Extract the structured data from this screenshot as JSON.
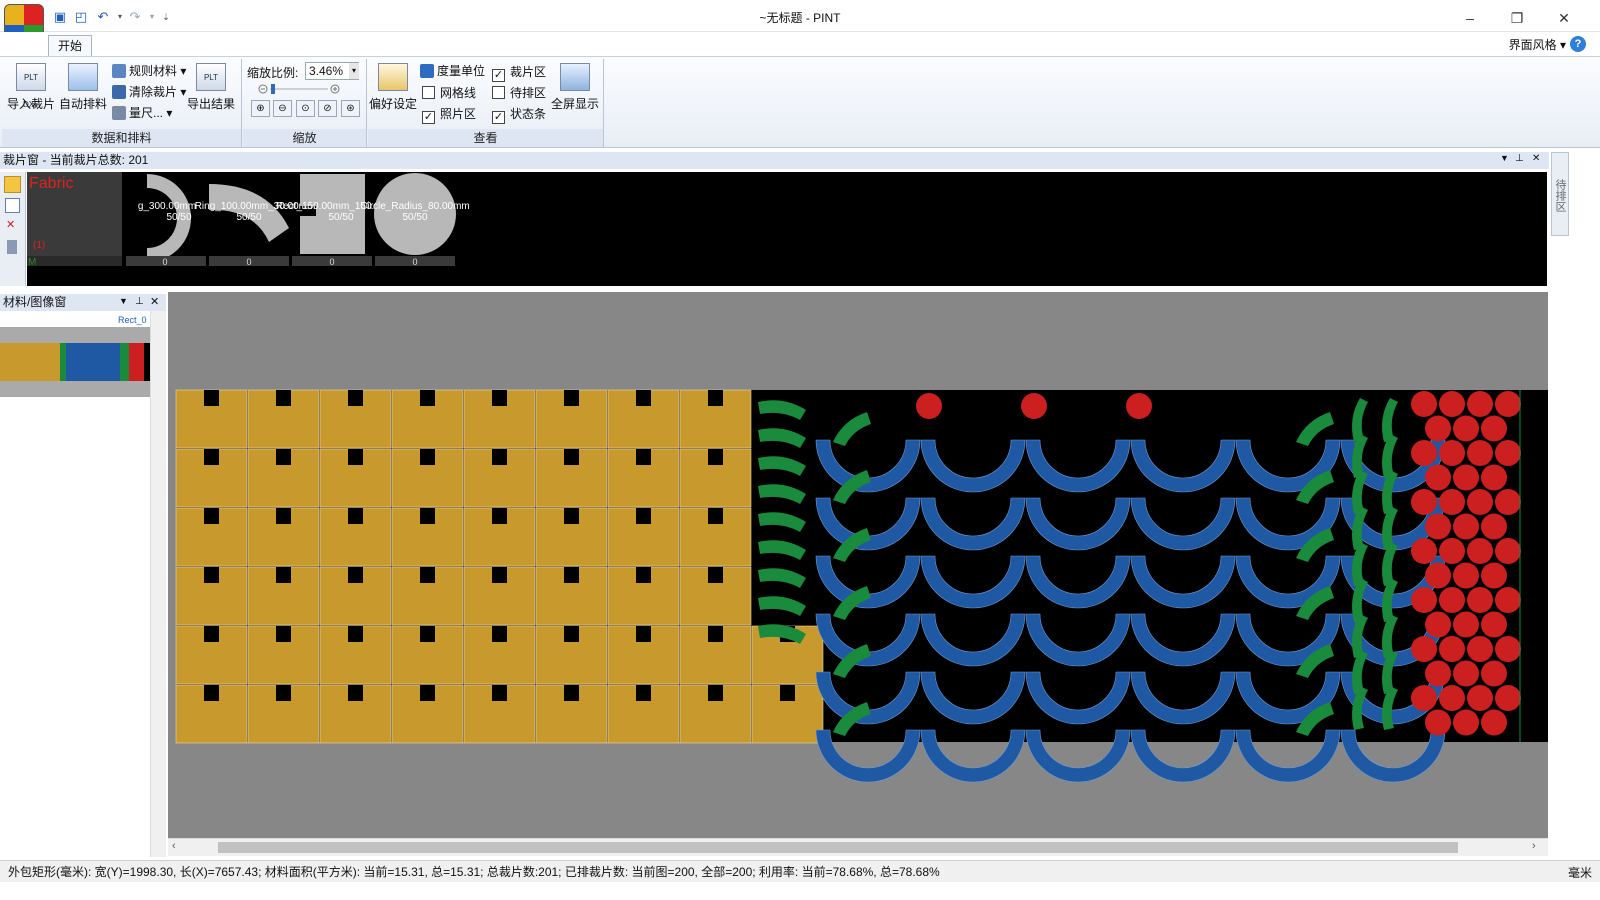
{
  "window": {
    "title": "~无标题 - PINT",
    "minimize": "–",
    "restore": "❐",
    "close": "✕"
  },
  "quick_access": {
    "save_icon": "save-icon",
    "saveas_icon": "save-as-icon",
    "undo_icon": "undo-icon",
    "redo_icon": "redo-icon",
    "customize_icon": "customize-icon"
  },
  "tabs": {
    "home": "开始"
  },
  "ui_style": "界面风格 ▾",
  "help": "?",
  "ribbon": {
    "data_group": {
      "caption": "数据和排料",
      "import_label": "导入裁片",
      "auto_label": "自动排料",
      "export_label": "导出结果",
      "rule_material": "规则材料 ▾",
      "clear_pieces": "清除裁片 ▾",
      "measure": "量尺... ▾",
      "import_icon_text": "PLT DXF",
      "export_icon_text": "PLT"
    },
    "zoom_group": {
      "caption": "缩放",
      "label": "缩放比例:",
      "value": "3.46%",
      "buttons": [
        "⊕",
        "⊖",
        "⊙",
        "⊘",
        "⊛"
      ]
    },
    "view_group": {
      "caption": "查看",
      "prefs_label": "偏好设定",
      "fullscreen_label": "全屏显示",
      "unit": "度量单位",
      "checks": [
        {
          "label": "裁片区",
          "checked": true
        },
        {
          "label": "网格线",
          "checked": false
        },
        {
          "label": "待排区",
          "checked": false
        },
        {
          "label": "照片区",
          "checked": true
        },
        {
          "label": "状态条",
          "checked": true
        }
      ]
    }
  },
  "piece_window": {
    "header": "裁片窗 - 当前裁片总数: 201",
    "fabric_label": "Fabric",
    "fabric_count": "(1)",
    "fabric_m": "M",
    "pieces": [
      {
        "name": "g_300.00mm",
        "qty": "50/50",
        "placed": "0"
      },
      {
        "name": "Ring_100.00mm_30.00mm",
        "qty": "50/50",
        "placed": "0"
      },
      {
        "name": "Rect_150.00mm_150.00mm",
        "qty": "50/50",
        "placed": "0"
      },
      {
        "name": "Circle_Radius_80.00mm",
        "qty": "50/50",
        "placed": "0"
      }
    ]
  },
  "material_window": {
    "header": "材料/图像窗",
    "thumb_label": "Rect_0"
  },
  "side_panel": "待排区",
  "statusbar": {
    "text": "外包矩形(毫米): 宽(Y)=1998.30, 长(X)=7657.43; 材料面积(平方米): 当前=15.31, 总=15.31; 总裁片数:201; 已排裁片数: 当前图=200, 全部=200; 利用率: 当前=78.68%, 总=78.68%",
    "unit": "毫米"
  },
  "colors": {
    "yellow": "#c89a2e",
    "blue": "#1f58a3",
    "green": "#1a8a3c",
    "red": "#cc1f1f",
    "canvas": "#878787"
  }
}
